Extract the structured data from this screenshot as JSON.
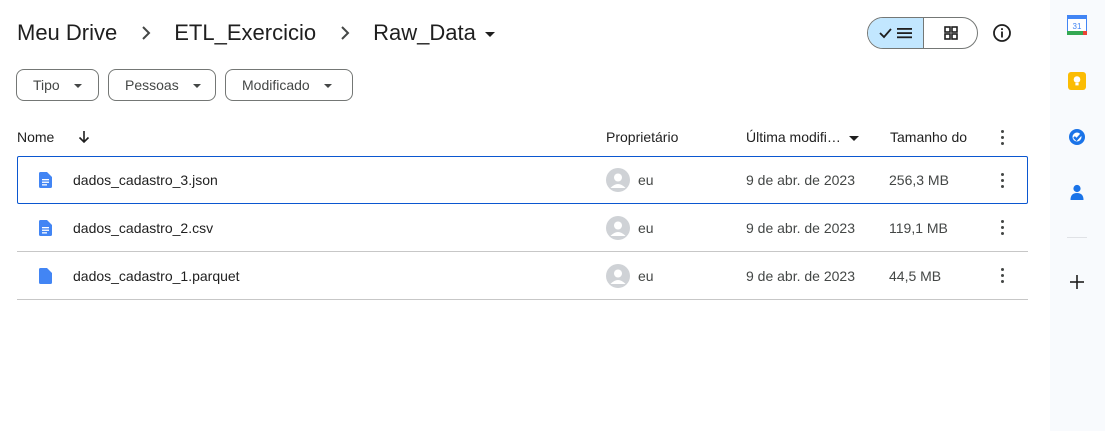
{
  "breadcrumb": {
    "items": [
      "Meu Drive",
      "ETL_Exercicio",
      "Raw_Data"
    ],
    "separator": "›"
  },
  "view_toggle": {
    "active": "list",
    "list_icon": "check-list-icon",
    "grid_icon": "grid-icon"
  },
  "info_icon": "info-icon",
  "filters": [
    {
      "label": "Tipo"
    },
    {
      "label": "Pessoas"
    },
    {
      "label": "Modificado"
    }
  ],
  "table": {
    "columns": {
      "name": "Nome",
      "owner": "Proprietário",
      "modified": "Última modifi…",
      "size": "Tamanho do"
    },
    "sort_icon": "arrow-down-icon",
    "rows": [
      {
        "name": "dados_cadastro_3.json",
        "owner": "eu",
        "modified": "9 de abr. de 2023",
        "size": "256,3 MB",
        "selected": true
      },
      {
        "name": "dados_cadastro_2.csv",
        "owner": "eu",
        "modified": "9 de abr. de 2023",
        "size": "119,1 MB",
        "selected": false
      },
      {
        "name": "dados_cadastro_1.parquet",
        "owner": "eu",
        "modified": "9 de abr. de 2023",
        "size": "44,5 MB",
        "selected": false
      }
    ]
  },
  "side_panel": {
    "apps": [
      "calendar-icon",
      "keep-icon",
      "tasks-icon",
      "contacts-icon"
    ],
    "calendar_day": "31",
    "add_icon": "plus-icon"
  },
  "colors": {
    "accent": "#0b57d0",
    "toggle_active_bg": "#c2e7ff",
    "file_icon": "#4285f4",
    "keep": "#fbbc04",
    "tasks": "#1a73e8",
    "contacts": "#1a73e8"
  }
}
